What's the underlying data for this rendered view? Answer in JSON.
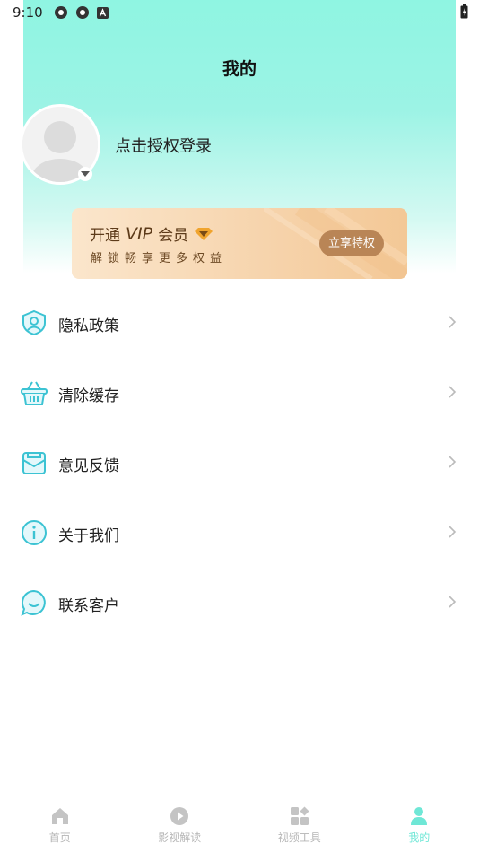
{
  "status_bar": {
    "time": "9:10"
  },
  "header": {
    "title": "我的"
  },
  "profile": {
    "login_prompt": "点击授权登录"
  },
  "vip": {
    "title_prefix": "开通",
    "title_vip": "VIP",
    "title_suffix": "会员",
    "subtitle": "解锁畅享更多权益",
    "button_label": "立享特权"
  },
  "menu": {
    "items": [
      {
        "label": "隐私政策",
        "icon": "privacy-shield-icon"
      },
      {
        "label": "清除缓存",
        "icon": "basket-icon"
      },
      {
        "label": "意见反馈",
        "icon": "feedback-box-icon"
      },
      {
        "label": "关于我们",
        "icon": "info-icon"
      },
      {
        "label": "联系客户",
        "icon": "chat-bubble-icon"
      }
    ]
  },
  "tab_bar": {
    "tabs": [
      {
        "label": "首页",
        "icon": "home-icon",
        "active": false
      },
      {
        "label": "影视解读",
        "icon": "play-icon",
        "active": false
      },
      {
        "label": "视频工具",
        "icon": "tools-grid-icon",
        "active": false
      },
      {
        "label": "我的",
        "icon": "person-icon",
        "active": true
      }
    ]
  },
  "colors": {
    "accent": "#6fe7d6",
    "hero_top": "#8ff5e2",
    "vip_button": "#b98556",
    "icon_teal": "#3cc3d3"
  }
}
